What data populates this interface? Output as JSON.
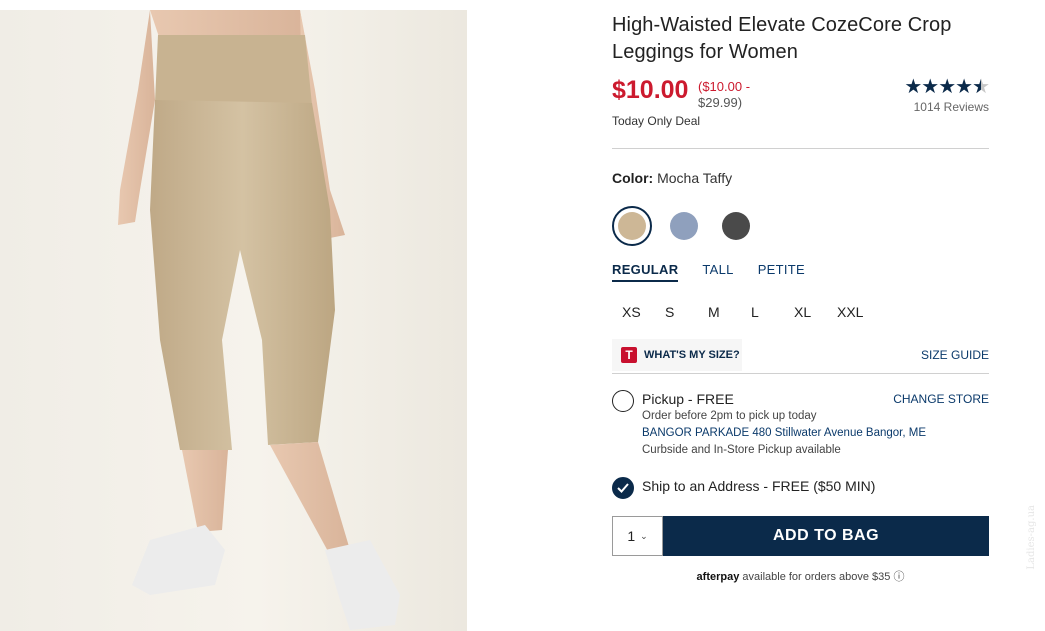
{
  "product": {
    "title": "High-Waisted Elevate CozeCore Crop Leggings for Women",
    "price": "$10.00",
    "price_range_low": "($10.00 -",
    "price_range_high": "$29.99)",
    "deal_text": "Today Only Deal",
    "rating_value": 4.5,
    "rating_stars": "★★★★",
    "half_star": "★",
    "reviews": "1014 Reviews"
  },
  "color": {
    "label": "Color:",
    "selected": "Mocha Taffy",
    "swatches": [
      {
        "name": "Mocha Taffy",
        "hex": "#cdb796",
        "selected": true
      },
      {
        "name": "Blue Heather",
        "hex": "#8fa0bd",
        "selected": false
      },
      {
        "name": "Charcoal",
        "hex": "#4a4a4a",
        "selected": false
      }
    ]
  },
  "fit_tabs": [
    "REGULAR",
    "TALL",
    "PETITE"
  ],
  "sizes": [
    "XS",
    "S",
    "M",
    "L",
    "XL",
    "XXL"
  ],
  "size_tools": {
    "logo_letter": "T",
    "whats_my_size": "WHAT'S MY SIZE?",
    "size_guide": "SIZE GUIDE"
  },
  "pickup": {
    "title": "Pickup - FREE",
    "change_store": "CHANGE STORE",
    "line1": "Order before 2pm to pick up today",
    "store": "BANGOR PARKADE 480 Stillwater Avenue  Bangor, ME",
    "line3": "Curbside and In-Store Pickup available"
  },
  "ship": {
    "title": "Ship to an Address - FREE ($50 MIN)"
  },
  "cart": {
    "quantity": "1",
    "add_label": "ADD TO BAG"
  },
  "afterpay": {
    "brand": "afterpay",
    "text": " available for orders above $35 ⓘ"
  },
  "watermark": "Ladies-ag.ua",
  "colors": {
    "price_red": "#cc1a2e",
    "navy": "#0b2a4a",
    "link_blue": "#0b3a6b"
  }
}
